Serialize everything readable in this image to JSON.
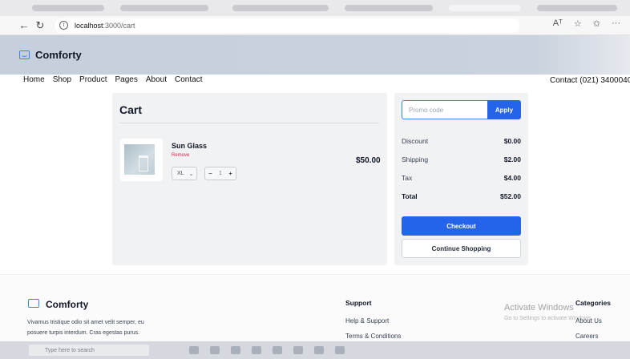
{
  "browser": {
    "url_host": "localhost",
    "url_path": ":3000/cart",
    "read_aloud_icon": "Aᵀ",
    "info_icon": "i"
  },
  "header": {
    "brand": "Comforty"
  },
  "nav": {
    "links": [
      "Home",
      "Shop",
      "Product",
      "Pages",
      "About",
      "Contact"
    ],
    "contact": "Contact (021) 3400040"
  },
  "cart": {
    "title": "Cart",
    "item": {
      "name": "Sun Glass",
      "remove_label": "Remove",
      "size": "XL",
      "quantity": "1",
      "price": "$50.00"
    }
  },
  "summary": {
    "promo_placeholder": "Promo code",
    "apply_label": "Apply",
    "rows": [
      {
        "label": "Discount",
        "value": "$0.00"
      },
      {
        "label": "Shipping",
        "value": "$2.00"
      },
      {
        "label": "Tax",
        "value": "$4.00"
      },
      {
        "label": "Total",
        "value": "$52.00"
      }
    ],
    "checkout_label": "Checkout",
    "continue_label": "Continue Shopping"
  },
  "footer": {
    "brand": "Comforty",
    "text_line1": "Vivamus tristique odio sit amet velit semper, eu",
    "text_line2": "posuere turpis interdum. Cras egestas purus.",
    "support_title": "Support",
    "support_links": [
      "Help & Support",
      "Terms & Conditions"
    ],
    "categories_title": "Categories",
    "category_links": [
      "About Us",
      "Careers"
    ],
    "watermark_title": "Activate Windows",
    "watermark_subtitle": "Go to Settings to activate Windows."
  },
  "taskbar": {
    "search_placeholder": "Type here to search"
  },
  "colors": {
    "accent": "#2563eb",
    "header_bg": "#c9d2de",
    "panel_bg": "#f1f2f4",
    "remove_red": "#e11d48"
  }
}
